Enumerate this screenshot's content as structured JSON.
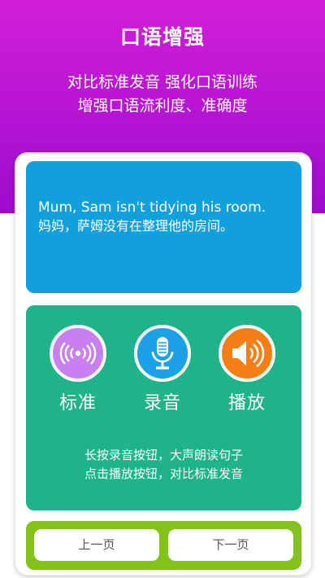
{
  "header": {
    "title": "口语增强",
    "subtitle_line1": "对比标准发音 强化口语训练",
    "subtitle_line2": "增强口语流利度、准确度"
  },
  "sentence": {
    "english": "Mum, Sam isn't tidying his room.",
    "chinese": "妈妈，萨姆没有在整理他的房间。"
  },
  "actions": [
    {
      "label": "标准",
      "icon": "standard-audio-icon",
      "color": "#c87ff0"
    },
    {
      "label": "录音",
      "icon": "microphone-icon",
      "color": "#1aa1e6"
    },
    {
      "label": "播放",
      "icon": "speaker-icon",
      "color": "#f57f14"
    }
  ],
  "instructions": {
    "line1": "长按录音按钮，大声朗读句子",
    "line2": "点击播放按钮，对比标准发音"
  },
  "navigation": {
    "prev_label": "上一页",
    "next_label": "下一页"
  },
  "colors": {
    "header_bg": "#b514d3",
    "sentence_bg": "#12a0dd",
    "practice_bg": "#1eb388",
    "nav_bg": "#83c21b"
  }
}
